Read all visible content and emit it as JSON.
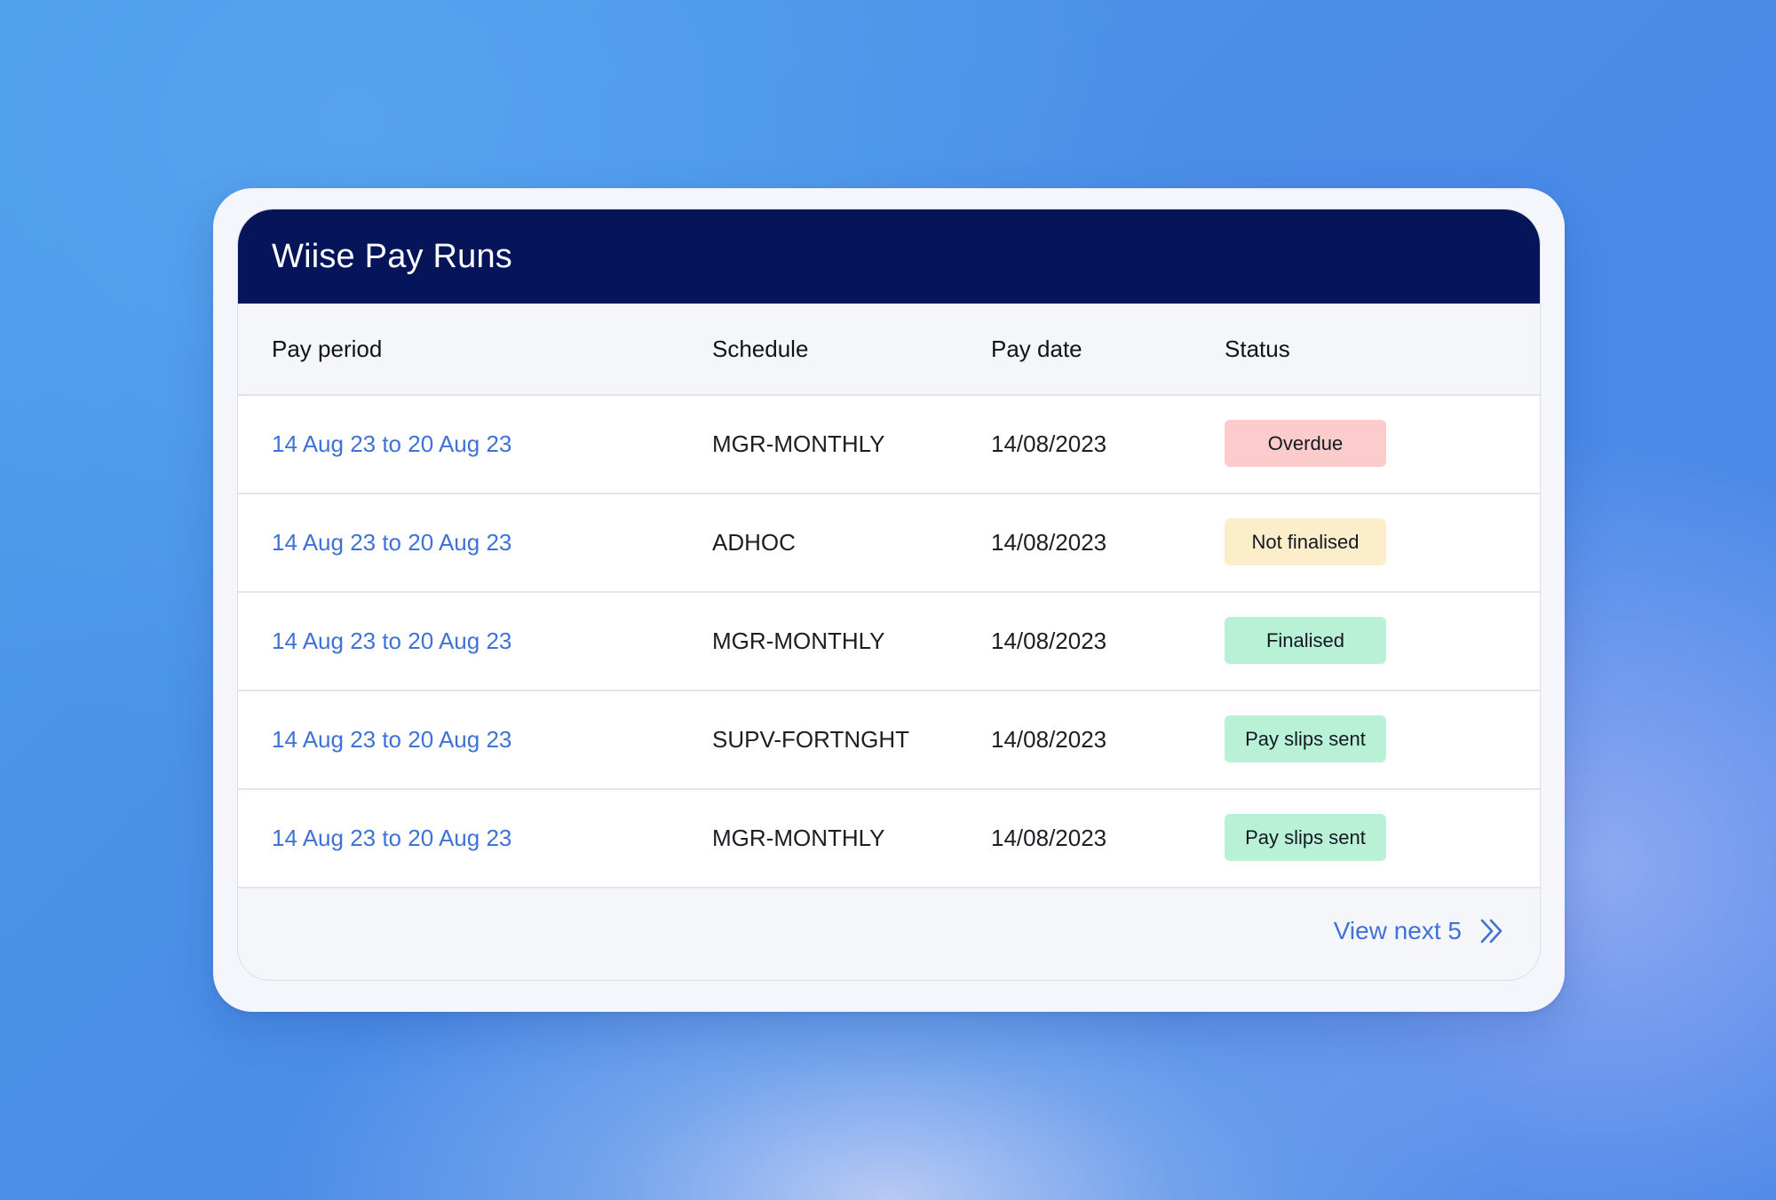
{
  "card": {
    "title": "Wiise Pay Runs"
  },
  "table": {
    "columns": [
      "Pay period",
      "Schedule",
      "Pay date",
      "Status"
    ],
    "rows": [
      {
        "period": "14 Aug 23 to 20 Aug 23",
        "schedule": "MGR-MONTHLY",
        "pay_date": "14/08/2023",
        "status": "Overdue"
      },
      {
        "period": "14 Aug 23 to 20 Aug 23",
        "schedule": "ADHOC",
        "pay_date": "14/08/2023",
        "status": "Not finalised"
      },
      {
        "period": "14 Aug 23 to 20 Aug 23",
        "schedule": "MGR-MONTHLY",
        "pay_date": "14/08/2023",
        "status": "Finalised"
      },
      {
        "period": "14 Aug 23 to 20 Aug 23",
        "schedule": "SUPV-FORTNGHT",
        "pay_date": "14/08/2023",
        "status": "Pay slips sent"
      },
      {
        "period": "14 Aug 23 to 20 Aug 23",
        "schedule": "MGR-MONTHLY",
        "pay_date": "14/08/2023",
        "status": "Pay slips sent"
      }
    ]
  },
  "footer": {
    "view_next_label": "View next 5",
    "view_next_icon": "double-chevron-right-icon"
  },
  "colors": {
    "header_bg": "#061459",
    "link": "#3f72d6",
    "overdue": "#fccccc",
    "not_finalised": "#fdeecb",
    "finalised": "#b8f1d6",
    "pay_slips_sent": "#b8f1d6"
  }
}
